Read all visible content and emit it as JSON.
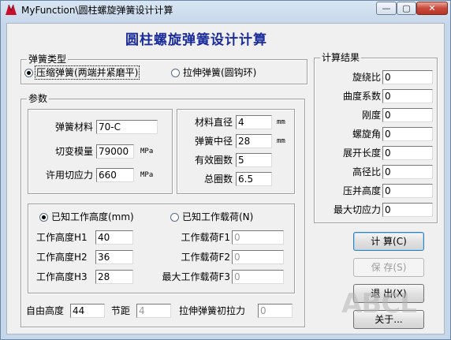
{
  "window": {
    "title": "MyFunction\\圆柱螺旋弹簧设计计算",
    "min_glyph": "—",
    "max_glyph": "▢",
    "close_glyph": "✕"
  },
  "heading": "圆柱螺旋弹簧设计计算",
  "spring_type": {
    "title": "弹簧类型",
    "option1": "压缩弹簧(两端并紧磨平)",
    "option2": "拉伸弹簧(圆钩环)",
    "selected": "option1"
  },
  "params": {
    "title": "参数",
    "material_label": "弹簧材料",
    "material_value": "70-C",
    "shear_modulus_label": "切变模量",
    "shear_modulus_value": "79000",
    "shear_modulus_unit": "MPa",
    "allow_stress_label": "许用切应力",
    "allow_stress_value": "660",
    "allow_stress_unit": "MPa",
    "wire_dia_label": "材料直径",
    "wire_dia_value": "4",
    "wire_dia_unit": "mm",
    "mean_dia_label": "弹簧中径",
    "mean_dia_value": "28",
    "mean_dia_unit": "mm",
    "active_coils_label": "有效圈数",
    "active_coils_value": "5",
    "total_coils_label": "总圈数",
    "total_coils_value": "6.5",
    "mode1": "已知工作高度(mm)",
    "mode2": "已知工作载荷(N)",
    "h1_label": "工作高度H1",
    "h1_value": "40",
    "h2_label": "工作高度H2",
    "h2_value": "36",
    "h3_label": "工作高度H3",
    "h3_value": "28",
    "f1_label": "工作载荷F1",
    "f1_value": "0",
    "f2_label": "工作载荷F2",
    "f2_value": "0",
    "f3_label": "最大工作载荷F3",
    "f3_value": "0",
    "free_height_label": "自由高度",
    "free_height_value": "44",
    "pitch_label": "节距",
    "pitch_value": "4",
    "init_tension_label": "拉伸弹簧初拉力",
    "init_tension_value": "0"
  },
  "results": {
    "title": "计算结果",
    "items": [
      {
        "label": "旋绕比",
        "value": "0"
      },
      {
        "label": "曲度系数",
        "value": "0"
      },
      {
        "label": "刚度",
        "value": "0"
      },
      {
        "label": "螺旋角",
        "value": "0"
      },
      {
        "label": "展开长度",
        "value": "0"
      },
      {
        "label": "高径比",
        "value": "0"
      },
      {
        "label": "压并高度",
        "value": "0"
      },
      {
        "label": "最大切应力",
        "value": "0"
      }
    ]
  },
  "buttons": {
    "calc": "计 算(C)",
    "save": "保 存(S)",
    "exit": "退 出(X)",
    "about": "关于..."
  },
  "watermark": "ABCL"
}
